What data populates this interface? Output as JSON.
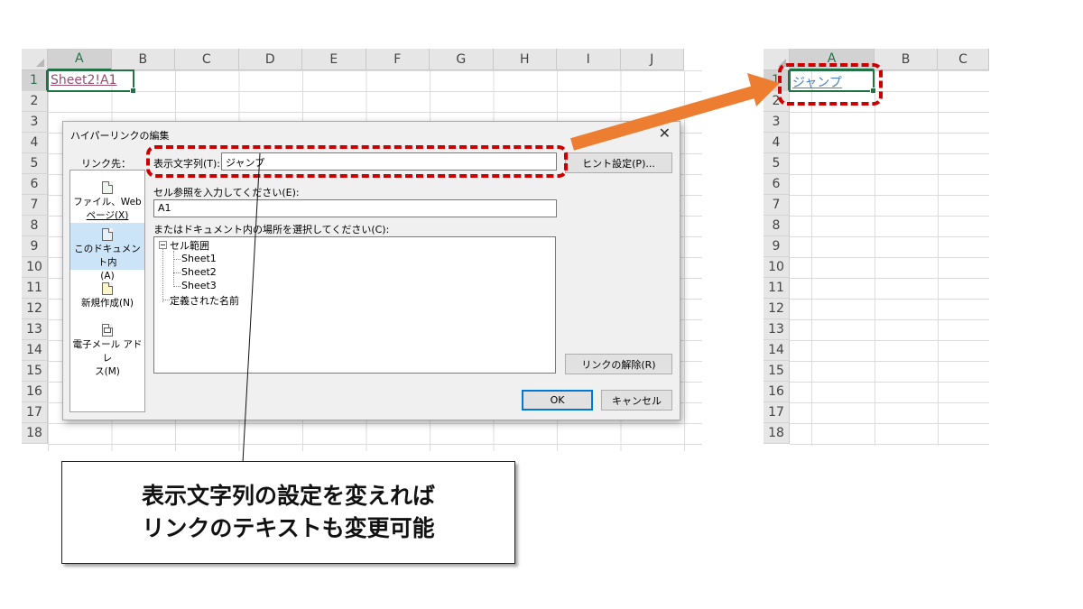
{
  "left_sheet": {
    "columns": [
      "A",
      "B",
      "C",
      "D",
      "E",
      "F",
      "G",
      "H",
      "I",
      "J"
    ],
    "rows": [
      "1",
      "2",
      "3",
      "4",
      "5",
      "6",
      "7",
      "8",
      "9",
      "10",
      "11",
      "12",
      "13",
      "14",
      "15",
      "16",
      "17",
      "18"
    ],
    "cell_a1": "Sheet2!A1",
    "link_color": "#954f72"
  },
  "right_sheet": {
    "columns": [
      "A",
      "B",
      "C"
    ],
    "rows": [
      "1",
      "2",
      "3",
      "4",
      "5",
      "6",
      "7",
      "8",
      "9",
      "10",
      "11",
      "12",
      "13",
      "14",
      "15",
      "16",
      "17",
      "18"
    ],
    "cell_a1": "ジャンプ",
    "link_color": "#4a7fc1"
  },
  "dialog": {
    "title": "ハイパーリンクの編集",
    "close": "✕",
    "link_to_label": "リンク先：",
    "link_to_items": [
      {
        "line1": "ファイル、Web",
        "line2": "ページ(X)",
        "icon": "file-web-icon"
      },
      {
        "line1": "このドキュメント内",
        "line2": "(A)",
        "icon": "this-document-icon"
      },
      {
        "line1": "新規作成(N)",
        "line2": "",
        "icon": "new-document-icon"
      },
      {
        "line1": "電子メール アドレ",
        "line2": "ス(M)",
        "icon": "email-address-icon"
      }
    ],
    "display_text_label": "表示文字列(T):",
    "display_text_value": "ジャンプ",
    "screentip_button": "ヒント設定(P)...",
    "cell_ref_label": "セル参照を入力してください(E):",
    "cell_ref_value": "A1",
    "place_label": "またはドキュメント内の場所を選択してください(C):",
    "tree": {
      "root": "セル範囲",
      "sheets": [
        "Sheet1",
        "Sheet2",
        "Sheet3"
      ],
      "defined_names": "定義された名前"
    },
    "remove_link_button": "リンクの解除(R)",
    "ok_button": "OK",
    "cancel_button": "キャンセル"
  },
  "callout": {
    "line1": "表示文字列の設定を変えれば",
    "line2": "リンクのテキストも変更可能"
  },
  "colors": {
    "highlight_dash": "#cc0000",
    "arrow": "#ed7d31",
    "excel_green": "#217346"
  }
}
